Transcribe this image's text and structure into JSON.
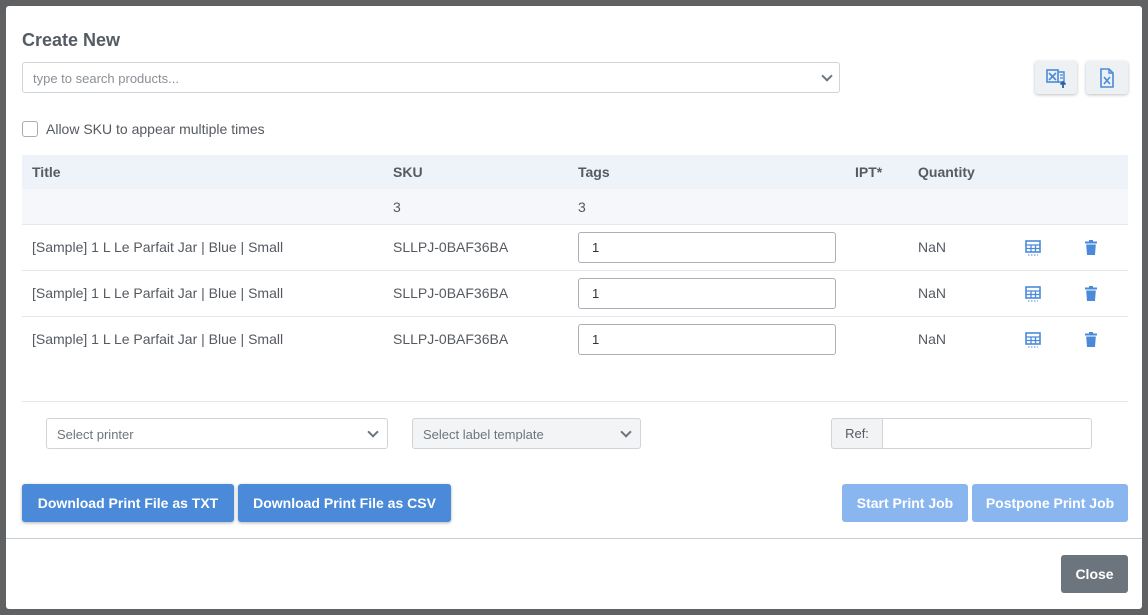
{
  "modal": {
    "title": "Create New",
    "search_placeholder": "type to search products...",
    "icons": [
      "excel-upload-icon",
      "excel-file-icon"
    ]
  },
  "options": {
    "allow_duplicate_label": "Allow SKU to appear multiple times",
    "allow_duplicate_checked": false
  },
  "table": {
    "headers": {
      "title": "Title",
      "sku": "SKU",
      "tags": "Tags",
      "ipt": "IPT*",
      "quantity": "Quantity"
    },
    "counts": {
      "sku": "3",
      "tags": "3"
    },
    "rows": [
      {
        "title": "[Sample] 1 L Le Parfait Jar | Blue | Small",
        "sku": "SLLPJ-0BAF36BA",
        "tags": "1",
        "quantity": "NaN"
      },
      {
        "title": "[Sample] 1 L Le Parfait Jar | Blue | Small",
        "sku": "SLLPJ-0BAF36BA",
        "tags": "1",
        "quantity": "NaN"
      },
      {
        "title": "[Sample] 1 L Le Parfait Jar | Blue | Small",
        "sku": "SLLPJ-0BAF36BA",
        "tags": "1",
        "quantity": "NaN"
      }
    ],
    "row_icons": [
      "grid-icon",
      "trash-icon"
    ]
  },
  "print": {
    "printer_placeholder": "Select printer",
    "template_placeholder": "Select label template",
    "ref_label": "Ref:",
    "ref_value": ""
  },
  "actions": {
    "download_txt": "Download Print File as TXT",
    "download_csv": "Download Print File as CSV",
    "start_job": "Start Print Job",
    "postpone_job": "Postpone Print Job",
    "close": "Close"
  },
  "colors": {
    "primary": "#4a8ad8",
    "primary_light": "#8ab6f0",
    "secondary": "#6c757d",
    "header_bg": "#eef2f9"
  }
}
